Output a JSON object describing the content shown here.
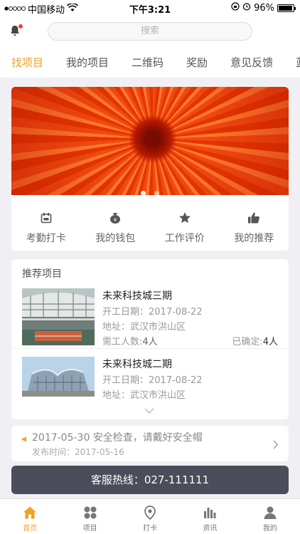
{
  "status_bar": {
    "carrier": "中国移动",
    "time": "下午3:21",
    "battery": "96%",
    "battery_level": 0.96
  },
  "header": {
    "search_placeholder": "搜索"
  },
  "tabs": [
    {
      "label": "找项目",
      "active": true
    },
    {
      "label": "我的项目"
    },
    {
      "label": "二维码"
    },
    {
      "label": "奖励"
    },
    {
      "label": "意见反馈"
    },
    {
      "label": "蓝"
    }
  ],
  "banner": {
    "pages": 2,
    "current_page": 1
  },
  "quick_actions": [
    {
      "label": "考勤打卡",
      "icon": "calendar-icon"
    },
    {
      "label": "我的钱包",
      "icon": "money-bag-icon"
    },
    {
      "label": "工作评价",
      "icon": "star-icon"
    },
    {
      "label": "我的推荐",
      "icon": "thumbs-up-icon"
    }
  ],
  "recommended": {
    "title": "推荐项目",
    "projects": [
      {
        "name": "未来科技城三期",
        "start_label": "开工日期：",
        "start_date": "2017-08-22",
        "address_label": "地址：",
        "address": "武汉市洪山区",
        "need_label": "需工人数:",
        "need_value": "4人",
        "confirmed_label": "已确定:",
        "confirmed_value": "4人"
      },
      {
        "name": "未来科技城二期",
        "start_label": "开工日期：",
        "start_date": "2017-08-22",
        "address_label": "地址：",
        "address": "武汉市洪山区"
      }
    ]
  },
  "notice": {
    "text": "2017-05-30 安全检查，请戴好安全帽",
    "publish": "发布时间：2017-05-16"
  },
  "hotline": {
    "label": "客服热线：027-111111"
  },
  "bottom_nav": [
    {
      "label": "首页",
      "icon": "home-icon",
      "active": true
    },
    {
      "label": "项目",
      "icon": "grid-icon"
    },
    {
      "label": "打卡",
      "icon": "location-pin-icon"
    },
    {
      "label": "资讯",
      "icon": "bar-chart-icon"
    },
    {
      "label": "我的",
      "icon": "person-icon"
    }
  ],
  "colors": {
    "accent": "#f0a223",
    "hotline_bg": "#4b4d5a",
    "page_bg": "#f0eff4"
  }
}
